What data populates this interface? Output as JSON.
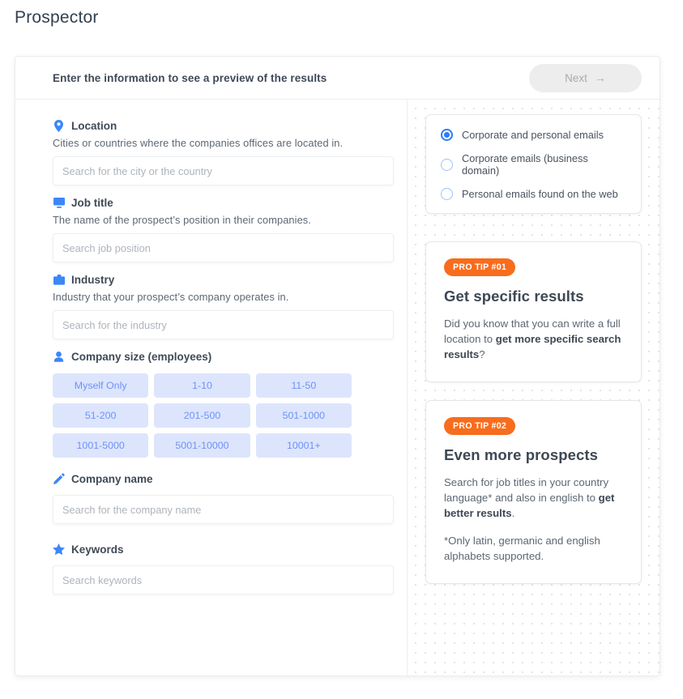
{
  "page": {
    "title": "Prospector"
  },
  "header": {
    "title": "Enter the information to see a preview of the results",
    "next_label": "Next",
    "next_arrow": "→"
  },
  "colors": {
    "accent_blue": "#3b87f7",
    "pill_bg": "#dde5fd",
    "pill_text": "#6d93f5",
    "orange": "#f86c1d",
    "disabled_btn": "#ededee"
  },
  "fields": [
    {
      "key": "location",
      "icon": "map-pin-icon",
      "label": "Location",
      "description": "Cities or countries where the companies offices are located in.",
      "placeholder": "Search for the city or the country",
      "value": ""
    },
    {
      "key": "job_title",
      "icon": "monitor-icon",
      "label": "Job title",
      "description": "The name of the prospect’s position in their companies.",
      "placeholder": "Search job position",
      "value": ""
    },
    {
      "key": "industry",
      "icon": "briefcase-icon",
      "label": "Industry",
      "description": "Industry that your prospect’s company operates in.",
      "placeholder": "Search for the industry",
      "value": ""
    }
  ],
  "company_size": {
    "icon": "user-icon",
    "label": "Company size (employees)",
    "options": [
      "Myself Only",
      "1-10",
      "11-50",
      "51-200",
      "201-500",
      "501-1000",
      "1001-5000",
      "5001-10000",
      "10001+"
    ]
  },
  "company_name": {
    "icon": "pencil-icon",
    "label": "Company name",
    "placeholder": "Search for the company name",
    "value": ""
  },
  "keywords": {
    "icon": "star-icon",
    "label": "Keywords",
    "placeholder": "Search keywords",
    "value": ""
  },
  "email_options": {
    "items": [
      {
        "label": "Corporate and personal emails",
        "selected": true
      },
      {
        "label": "Corporate emails (business domain)",
        "selected": false
      },
      {
        "label": "Personal emails found on the web",
        "selected": false
      }
    ]
  },
  "tips": [
    {
      "badge": "PRO TIP #01",
      "title": "Get specific results",
      "text_parts": [
        {
          "t": "Did you know that you can write a full location to ",
          "b": false
        },
        {
          "t": "get more specific search results",
          "b": true
        },
        {
          "t": "?",
          "b": false
        }
      ]
    },
    {
      "badge": "PRO TIP #02",
      "title": "Even more prospects",
      "text_parts": [
        {
          "t": "Search for job titles in your country language* and also in english to ",
          "b": false
        },
        {
          "t": "get better results",
          "b": true
        },
        {
          "t": ".",
          "b": false
        }
      ],
      "footnote": "*Only latin, germanic and english alphabets supported."
    }
  ]
}
